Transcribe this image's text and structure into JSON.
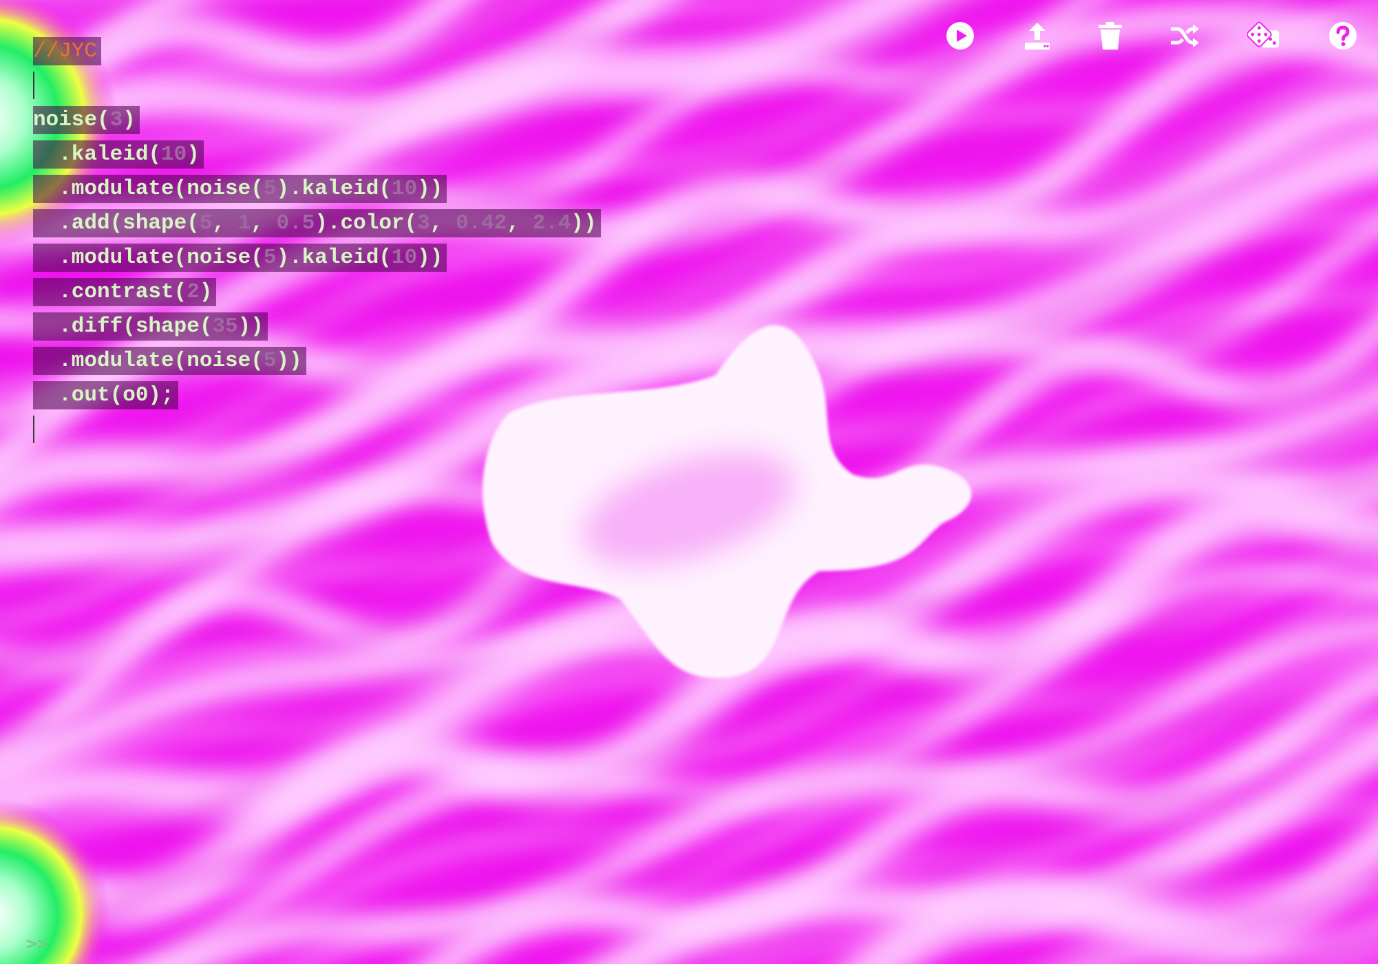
{
  "toolbar": {
    "buttons": [
      {
        "name": "play-button",
        "icon": "play-circle-icon"
      },
      {
        "name": "upload-button",
        "icon": "upload-icon"
      },
      {
        "name": "clear-button",
        "icon": "trash-icon"
      },
      {
        "name": "shuffle-button",
        "icon": "shuffle-icon"
      },
      {
        "name": "random-button",
        "icon": "dice-icon"
      },
      {
        "name": "help-button",
        "icon": "help-circle-icon"
      }
    ],
    "icon_color": "#ffffff"
  },
  "editor": {
    "comment": "//JYC",
    "lines": [
      {
        "tokens": [
          {
            "t": "noise("
          },
          {
            "t": "3",
            "n": true
          },
          {
            "t": ")"
          }
        ]
      },
      {
        "tokens": [
          {
            "t": "  .kaleid("
          },
          {
            "t": "10",
            "n": true
          },
          {
            "t": ")"
          }
        ]
      },
      {
        "tokens": [
          {
            "t": "  .modulate(noise("
          },
          {
            "t": "5",
            "n": true
          },
          {
            "t": ").kaleid("
          },
          {
            "t": "10",
            "n": true
          },
          {
            "t": "))"
          }
        ]
      },
      {
        "tokens": [
          {
            "t": "  .add(shape("
          },
          {
            "t": "5",
            "n": true
          },
          {
            "t": ", "
          },
          {
            "t": "1",
            "n": true
          },
          {
            "t": ", "
          },
          {
            "t": "0.5",
            "n": true
          },
          {
            "t": ").color("
          },
          {
            "t": "3",
            "n": true
          },
          {
            "t": ", "
          },
          {
            "t": "0.42",
            "n": true
          },
          {
            "t": ", "
          },
          {
            "t": "2.4",
            "n": true
          },
          {
            "t": "))"
          }
        ]
      },
      {
        "tokens": [
          {
            "t": "  .modulate(noise("
          },
          {
            "t": "5",
            "n": true
          },
          {
            "t": ").kaleid("
          },
          {
            "t": "10",
            "n": true
          },
          {
            "t": "))"
          }
        ]
      },
      {
        "tokens": [
          {
            "t": "  .contrast("
          },
          {
            "t": "2",
            "n": true
          },
          {
            "t": ")"
          }
        ]
      },
      {
        "tokens": [
          {
            "t": "  .diff(shape("
          },
          {
            "t": "35",
            "n": true
          },
          {
            "t": "))"
          }
        ]
      },
      {
        "tokens": [
          {
            "t": "  .modulate(noise("
          },
          {
            "t": "5",
            "n": true
          },
          {
            "t": "))"
          }
        ]
      },
      {
        "tokens": [
          {
            "t": "  .out(o0);"
          }
        ]
      }
    ],
    "text_color": "#d8f5c4",
    "number_color": "#a06aa0",
    "comment_color": "#e07a2a",
    "highlight_color": "rgba(70,0,70,0.55)"
  },
  "console": {
    "prompt": ">>"
  },
  "colors": {
    "magenta": "#ff00ff",
    "white": "#ffffff",
    "accent_green": "#22ee66"
  }
}
